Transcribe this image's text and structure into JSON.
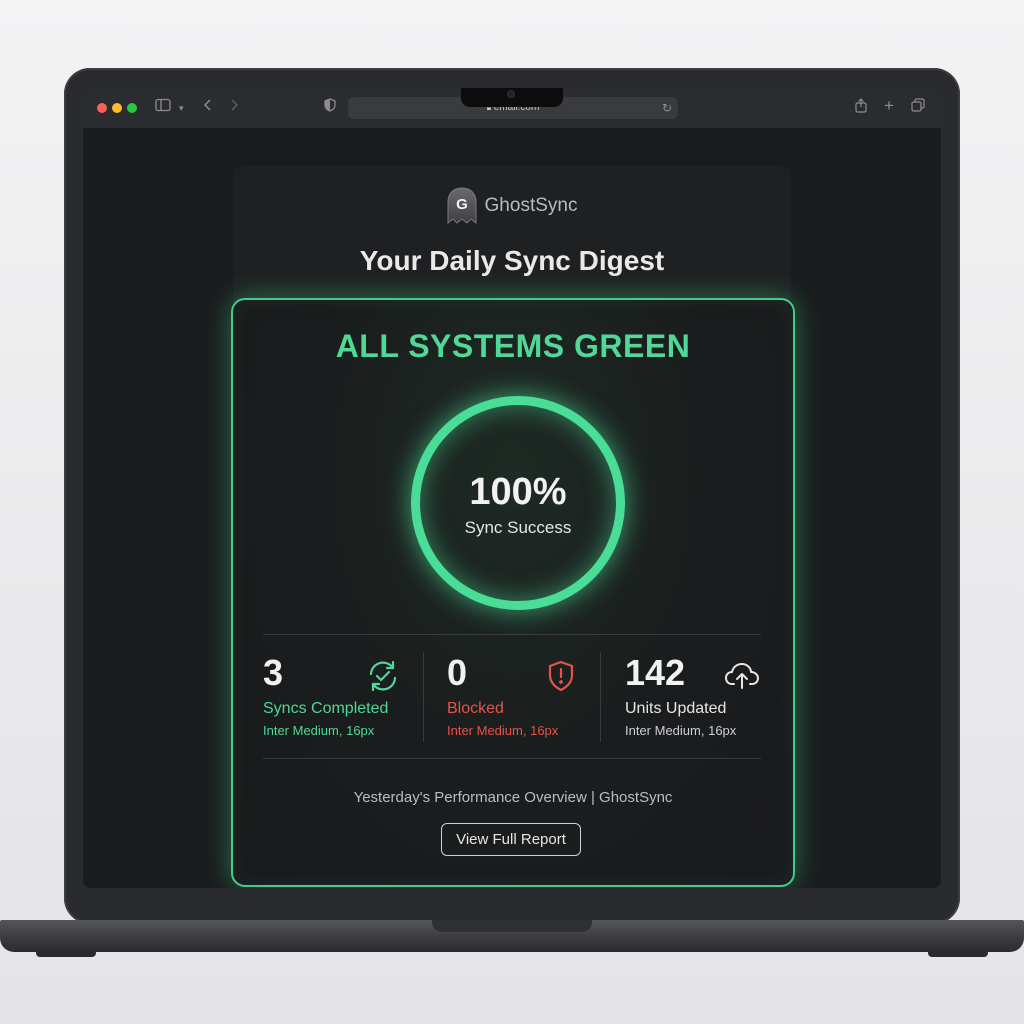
{
  "browser": {
    "url": "email.com"
  },
  "email": {
    "brand": {
      "logo_letter": "G",
      "name": "GhostSync"
    },
    "headline": "Your Daily Sync Digest",
    "status_title": "ALL SYSTEMS GREEN",
    "success_ring": {
      "value": "100%",
      "label": "Sync Success",
      "fraction": 1.0
    },
    "stats": [
      {
        "value": "3",
        "label": "Syncs Completed",
        "sub": "Inter Medium, 16px",
        "icon": "sync-check-icon",
        "color": "#4fd896"
      },
      {
        "value": "0",
        "label": "Blocked",
        "sub": "Inter Medium, 16px",
        "icon": "shield-alert-icon",
        "color": "#e5534b"
      },
      {
        "value": "142",
        "label": "Units Updated",
        "sub": "Inter Medium, 16px",
        "icon": "cloud-upload-icon",
        "color": "#e6e6e6"
      }
    ],
    "footer_text": "Yesterday's Performance Overview | GhostSync",
    "report_button": "View Full Report"
  },
  "colors": {
    "accent_green": "#4fd896",
    "alert_red": "#e5534b",
    "background": "#1a1b1d"
  }
}
